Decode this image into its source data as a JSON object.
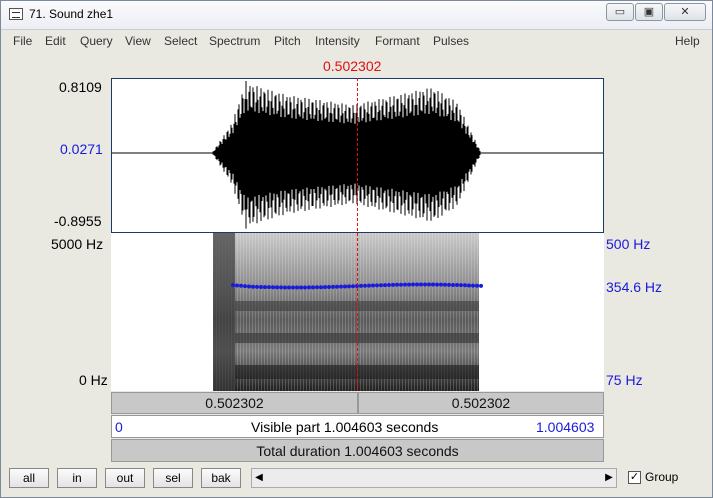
{
  "window": {
    "title": "71. Sound zhe1"
  },
  "titlebar_buttons": {
    "minimize": "▭",
    "restore": "▣",
    "close": "✕"
  },
  "menu": [
    "File",
    "Edit",
    "Query",
    "View",
    "Select",
    "Spectrum",
    "Pitch",
    "Intensity",
    "Formant",
    "Pulses"
  ],
  "menu_help": "Help",
  "cursor": {
    "time_label": "0.502302"
  },
  "waveform": {
    "max_label": "0.8109",
    "mid_label": "0.0271",
    "min_label": "-0.8955"
  },
  "spectrogram": {
    "top_freq_label": "5000 Hz",
    "bottom_freq_label": "0 Hz",
    "pitch_top_label": "500 Hz",
    "pitch_value_label": "354.6 Hz",
    "pitch_bottom_label": "75 Hz"
  },
  "timebar": {
    "left_segment": "0.502302",
    "right_segment": "0.502302",
    "start": "0",
    "end": "1.004603",
    "visible_part": "Visible part 1.004603 seconds",
    "total_duration": "Total duration 1.004603 seconds"
  },
  "buttons": {
    "all": "all",
    "in": "in",
    "out": "out",
    "sel": "sel",
    "bak": "bak"
  },
  "scrollbar": {
    "left_arrow": "◀",
    "right_arrow": "▶"
  },
  "group": {
    "label": "Group",
    "checked": true,
    "check_mark": "✓"
  },
  "colors": {
    "cursor": "#e01010",
    "pitch": "#1a1adb",
    "frame": "#1a3a6a"
  }
}
